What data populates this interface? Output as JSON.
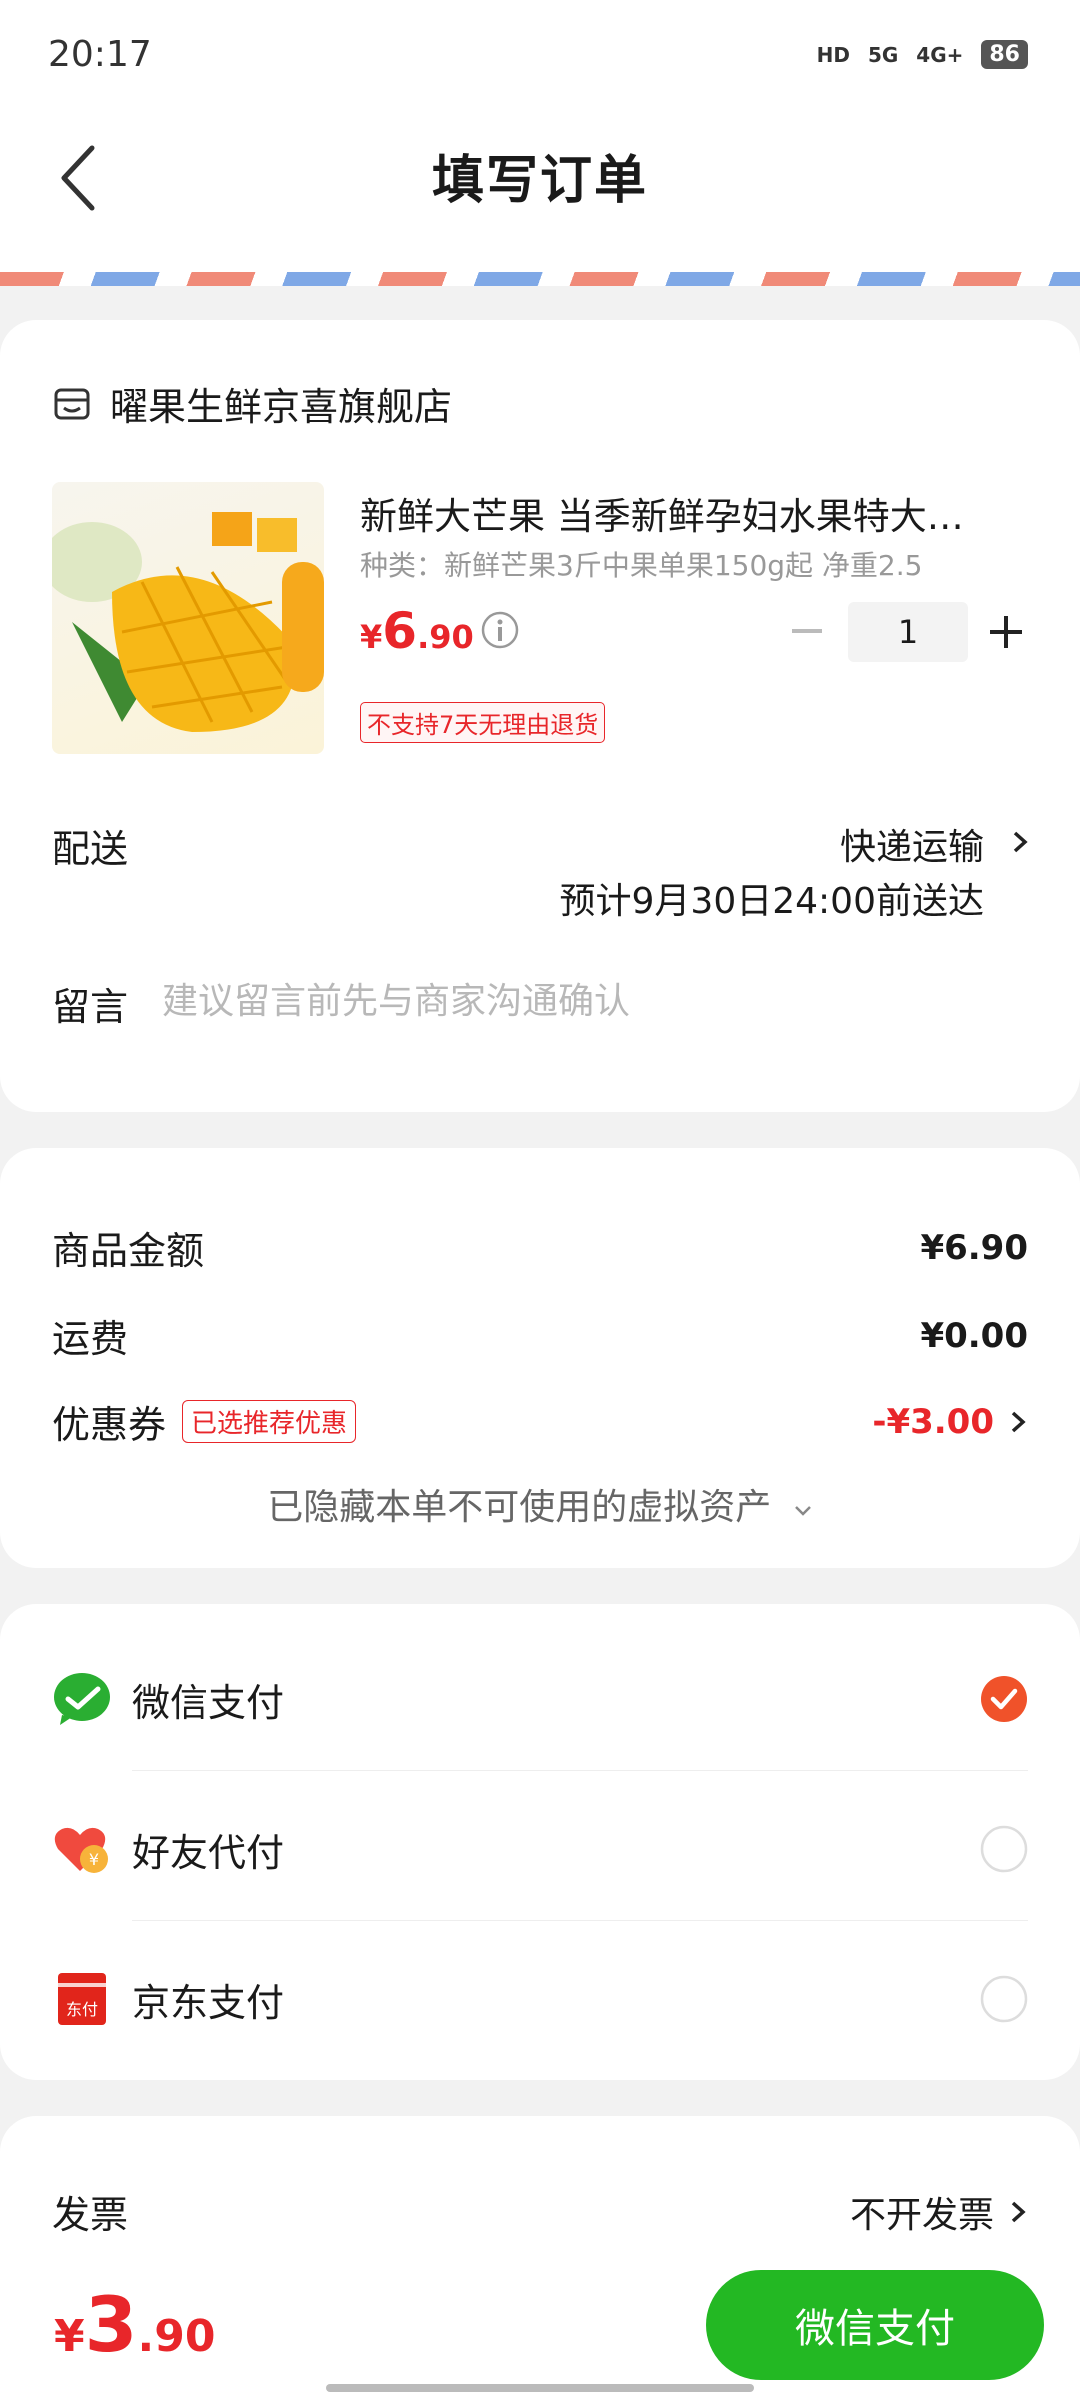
{
  "status_bar": {
    "time": "20:17",
    "net1": "HD",
    "net2": "5G",
    "net3": "4G+",
    "battery": "86"
  },
  "header": {
    "title": "填写订单"
  },
  "store": {
    "name": "曜果生鲜京喜旗舰店"
  },
  "product": {
    "title": "新鲜大芒果 当季新鲜孕妇水果特大…",
    "spec": "种类：新鲜芒果3斤中果单果150g起 净重2.5",
    "price_symbol": "¥",
    "price_int": "6",
    "price_dec": ".90",
    "quantity": "1",
    "return_tag": "不支持7天无理由退货"
  },
  "delivery": {
    "label": "配送",
    "mode": "快递运输",
    "eta": "预计9月30日24:00前送达"
  },
  "message": {
    "label": "留言",
    "placeholder": "建议留言前先与商家沟通确认"
  },
  "summary": {
    "goods_label": "商品金额",
    "goods_value": "¥6.90",
    "shipping_label": "运费",
    "shipping_value": "¥0.00",
    "coupon_label": "优惠券",
    "coupon_tag": "已选推荐优惠",
    "coupon_value": "-¥3.00",
    "hidden_assets": "已隐藏本单不可使用的虚拟资产"
  },
  "payment": {
    "options": [
      {
        "label": "微信支付",
        "selected": true
      },
      {
        "label": "好友代付",
        "selected": false
      },
      {
        "label": "京东支付",
        "selected": false
      }
    ]
  },
  "invoice": {
    "label": "发票",
    "value": "不开发票"
  },
  "footer": {
    "total_symbol": "¥",
    "total_int": "3",
    "total_dec": ".90",
    "pay_button": "微信支付"
  },
  "colors": {
    "accent_red": "#e8262a",
    "wechat_green": "#23b823",
    "check_orange": "#f0522a"
  }
}
